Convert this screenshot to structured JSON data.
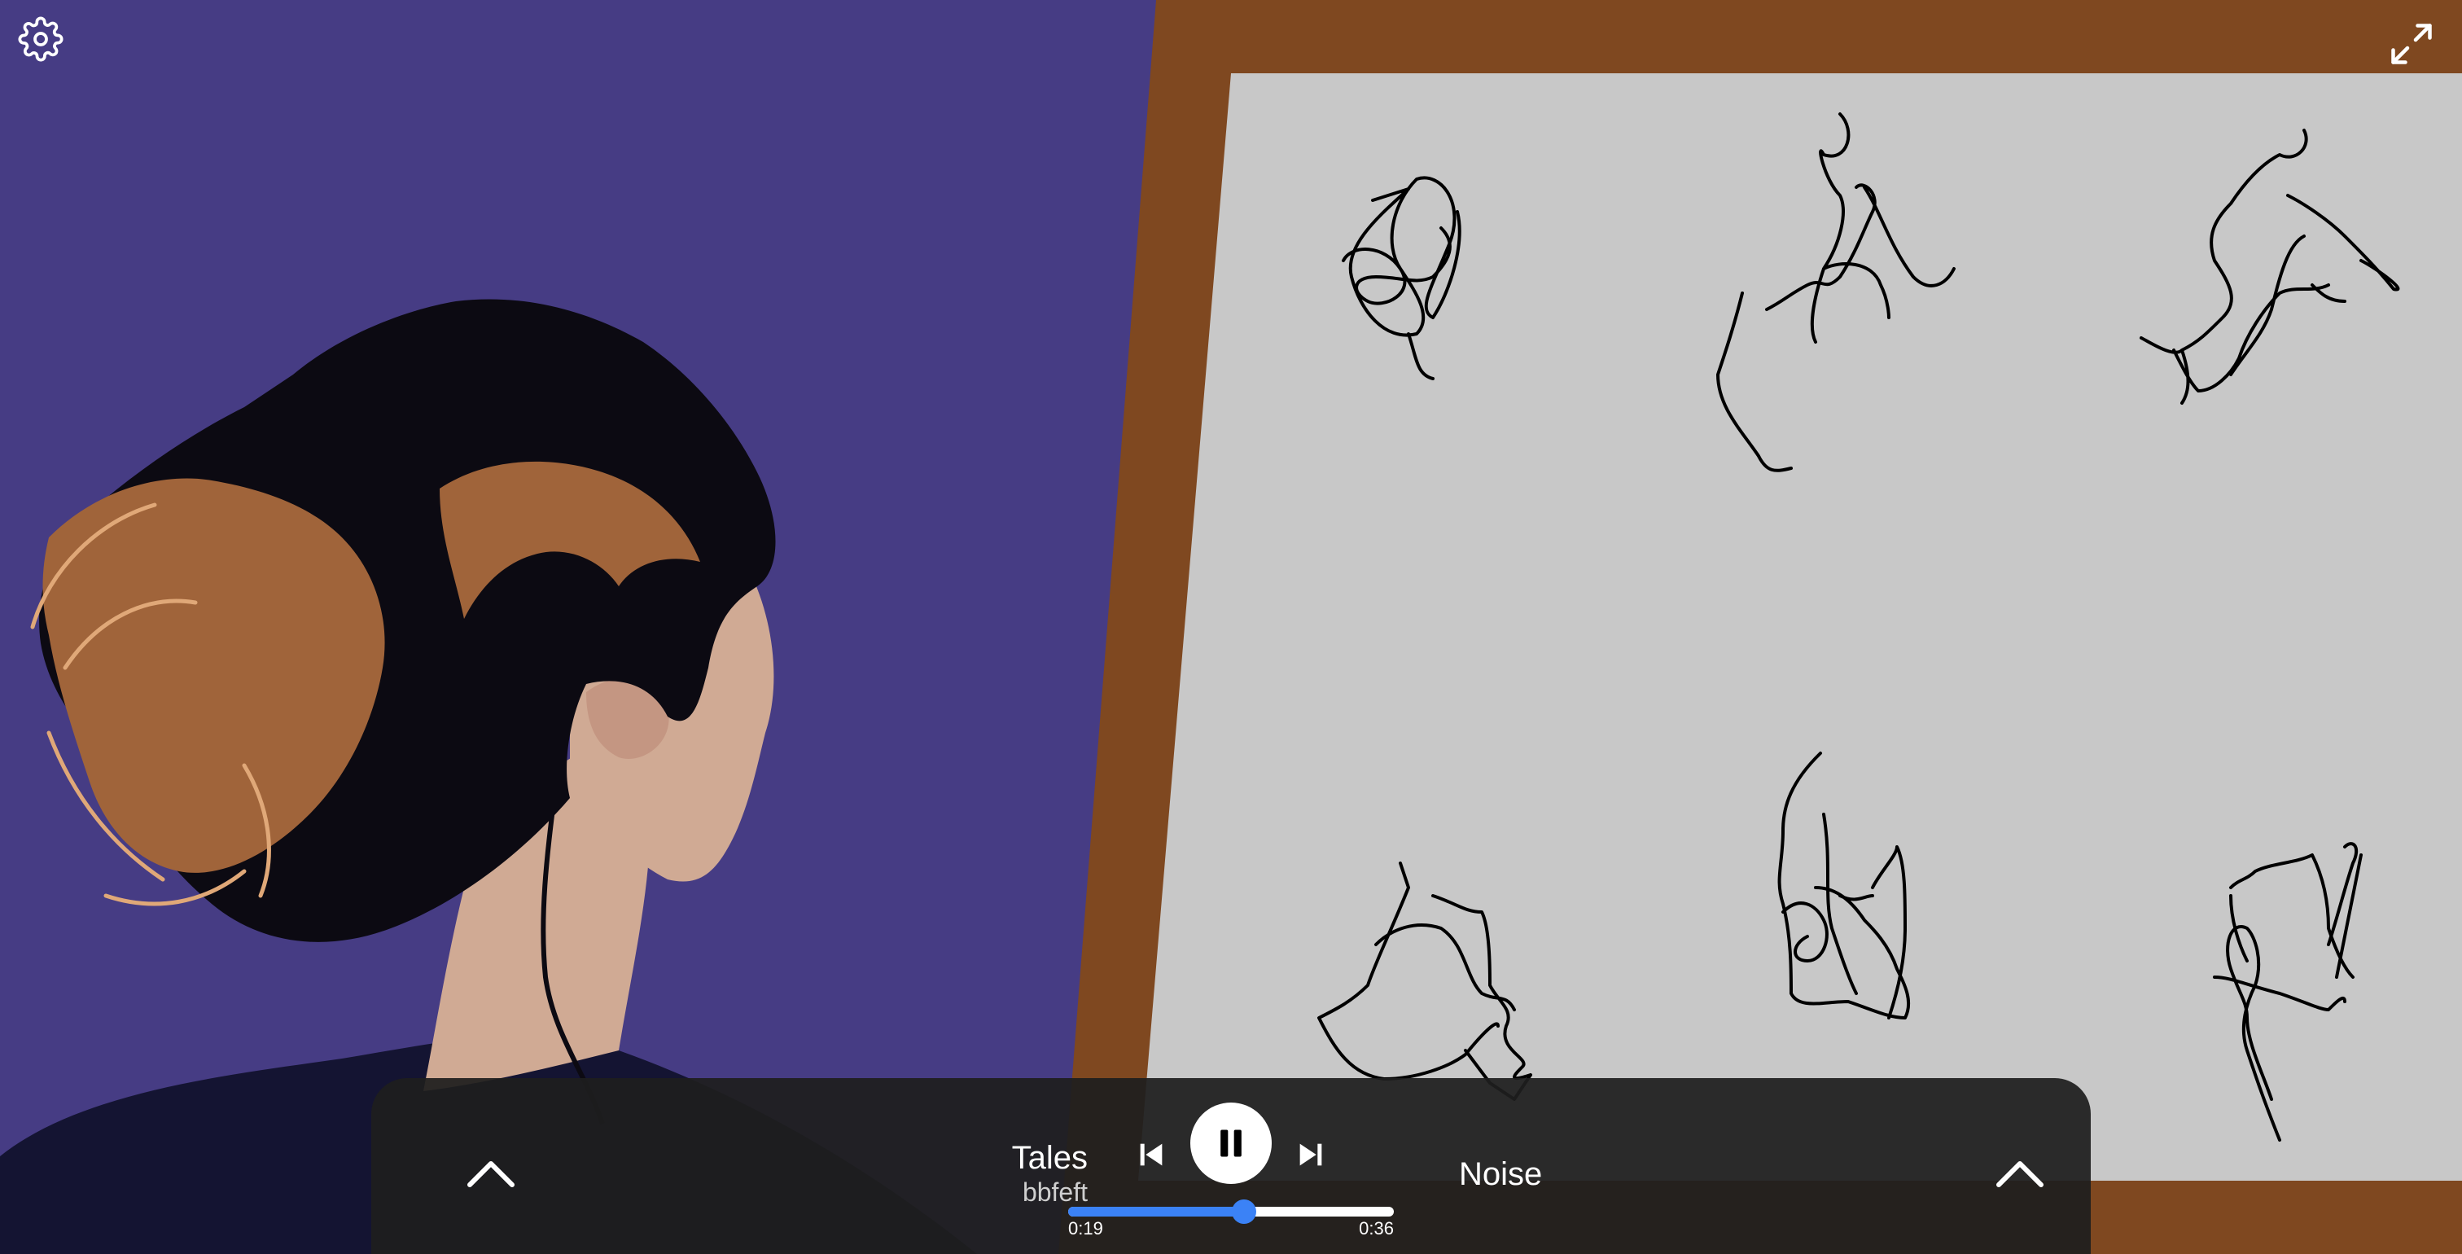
{
  "icons": {
    "settings": "gear-icon",
    "fullscreen": "expand-icon",
    "left_panel": "chevron-up-icon",
    "right_panel": "chevron-up-icon",
    "previous": "skip-previous-icon",
    "pause": "pause-icon",
    "next": "skip-next-icon"
  },
  "player": {
    "title": "Tales",
    "artist": "bbfeft",
    "sound": "Noise",
    "time_current": "0:19",
    "time_total": "0:36",
    "progress_fraction": 0.54
  },
  "colors": {
    "background": "#463c84",
    "frame": "#7f4820",
    "canvas": "#c8c8c8",
    "accent": "#3b82f6",
    "hair": "#0c0a12",
    "hair_highlight": "#a0643a",
    "skin": "#d0aa94"
  }
}
